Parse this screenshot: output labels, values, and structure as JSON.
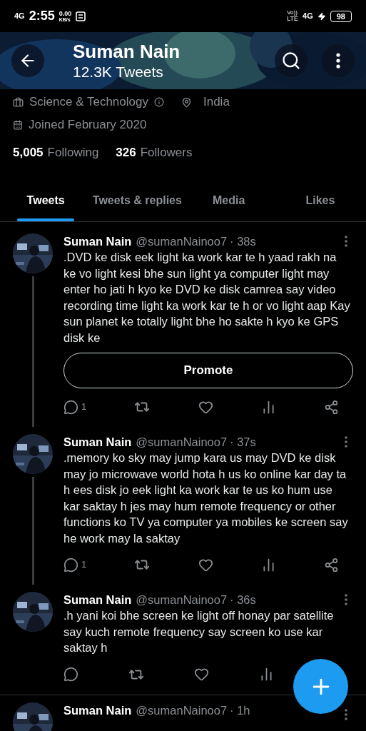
{
  "status_bar": {
    "network": "4G",
    "time": "2:55",
    "speed": "0.00",
    "speed_unit": "KB/s",
    "volte_top": "Vo))",
    "volte_bottom": "LTE",
    "network_right": "4G",
    "battery": "98"
  },
  "header": {
    "name": "Suman Nain",
    "tweet_count": "12.3K Tweets"
  },
  "profile": {
    "category": "Science & Technology",
    "location": "India",
    "joined": "Joined February 2020",
    "following_count": "5,005",
    "following_label": "Following",
    "followers_count": "326",
    "followers_label": "Followers"
  },
  "tabs": [
    {
      "label": "Tweets",
      "selected": true
    },
    {
      "label": "Tweets & replies",
      "selected": false
    },
    {
      "label": "Media",
      "selected": false
    },
    {
      "label": "Likes",
      "selected": false
    }
  ],
  "tweets": [
    {
      "name": "Suman Nain",
      "handle": "@sumanNainoo7",
      "time": "· 38s",
      "text": ".DVD ke disk eek light ka work kar te h yaad rakh na ke vo light kesi bhe sun light ya computer light may enter ho jati h kyo ke DVD ke disk camrea say video recording time light ka work kar te h or vo light aap Kay sun planet ke totally light bhe ho sakte h kyo ke GPS disk ke",
      "promote": "Promote",
      "replies": "1",
      "thread": true
    },
    {
      "name": "Suman Nain",
      "handle": "@sumanNainoo7",
      "time": "· 37s",
      "text": ".memory ko sky may jump kara us may DVD ke disk may jo microwave world hota h us ko online kar day ta h ees disk jo eek light ka work kar te us ko hum use kar saktay h jes may hum remote frequency or other functions ko TV ya computer ya mobiles ke screen say he work may la saktay",
      "replies": "1",
      "thread": true
    },
    {
      "name": "Suman Nain",
      "handle": "@sumanNainoo7",
      "time": "· 36s",
      "text": ".h yani koi bhe screen ke light off honay par satellite say kuch remote frequency say screen ko use kar saktay h",
      "thread": false
    },
    {
      "name": "Suman Nain",
      "handle": "@sumanNainoo7",
      "time": "· 1h",
      "thread": false
    }
  ]
}
